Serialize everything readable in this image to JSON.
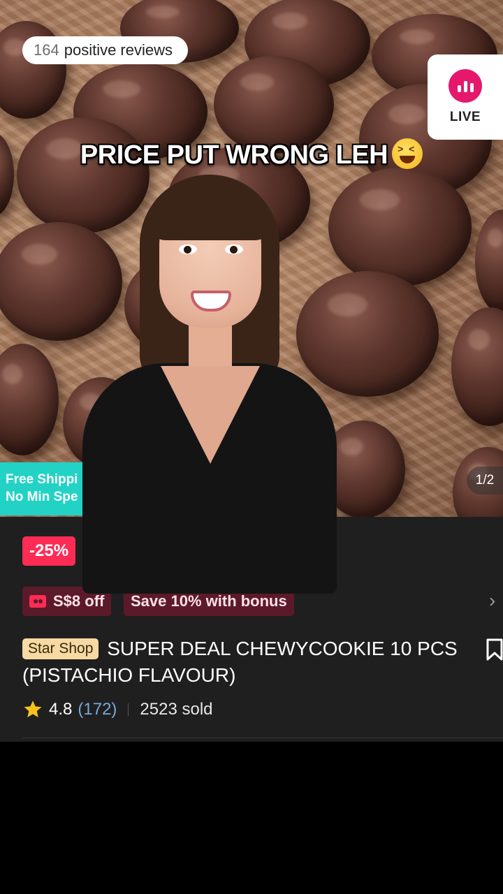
{
  "hero": {
    "reviews": {
      "count": "164",
      "label": "positive reviews"
    },
    "live": {
      "label": "LIVE",
      "accent": "#e5186b"
    },
    "caption": "PRICE PUT WRONG LEH",
    "caption_emoji": "grinning-squinting-face-emoji",
    "shipping_badge": {
      "line1": "Free Shippi",
      "line2": "No Min Spe"
    },
    "page_indicator": "1/2"
  },
  "product": {
    "discount": "-25%",
    "coupons": [
      {
        "label": "S$8 off",
        "icon": "ticket-icon"
      },
      {
        "label": "Save 10% with bonus"
      }
    ],
    "shop_badge": "Star Shop",
    "title": "SUPER DEAL CHEWYCOOKIE 10 PCS (PISTACHIO FLAVOUR)",
    "rating": "4.8",
    "rating_count": "(172)",
    "sold": "2523 sold"
  },
  "colors": {
    "discount": "#fe2c55",
    "coupon_bg": "#5b1a2a",
    "shipping": "#22d3c5",
    "star_shop": "#f6d9a3",
    "star": "#f7c21b",
    "rating_count": "#7aa8d8"
  }
}
